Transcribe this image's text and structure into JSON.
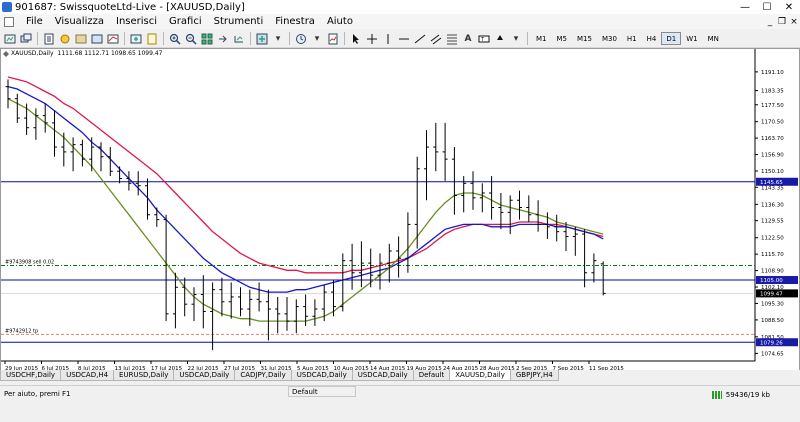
{
  "window": {
    "title": "901687: SwissquoteLtd-Live - [XAUUSD,Daily]",
    "minimize_glyph": "—",
    "maximize_glyph": "☐",
    "close_glyph": "✕"
  },
  "menu": {
    "items": [
      "File",
      "Visualizza",
      "Inserisci",
      "Grafici",
      "Strumenti",
      "Finestra",
      "Aiuto"
    ],
    "child_minimize_glyph": "_",
    "child_restore_glyph": "❐",
    "child_close_glyph": "×"
  },
  "toolbar": {
    "timeframes": [
      "M1",
      "M5",
      "M15",
      "M30",
      "H1",
      "H4",
      "D1",
      "W1",
      "MN"
    ],
    "active_timeframe": "D1"
  },
  "chart": {
    "symbol_label": "XAUUSD,Daily",
    "ohlc_label": "1111.68 1112.71 1098.65 1099.47",
    "line_labels": {
      "sell_order": "#9743908 sell 0.02",
      "take_profit": "#9742912 tp"
    },
    "price_tags": [
      {
        "label": "1145.65",
        "color": "#1a1aa8"
      },
      {
        "label": "1105.00",
        "color": "#1a1aa8"
      },
      {
        "label": "1099.47",
        "color": "#000000"
      },
      {
        "label": "1079.26",
        "color": "#1a1aa8"
      }
    ],
    "colors": {
      "background": "#ffffff",
      "candles": "#000000",
      "ma_red": "#e0154b",
      "ma_blue": "#1818c8",
      "ma_olive": "#6b8e23",
      "hline": "#0a0aa5",
      "order_line": "#007a00",
      "tp_line": "#e08080"
    }
  },
  "chart_data": {
    "type": "candlestick",
    "title": "XAUUSD,Daily",
    "y_tick_labels": [
      "1191.10",
      "1183.35",
      "1177.50",
      "1170.50",
      "1163.70",
      "1156.90",
      "1150.10",
      "1143.35",
      "1136.30",
      "1129.55",
      "1122.50",
      "1115.70",
      "1108.90",
      "1102.10",
      "1095.30",
      "1088.50",
      "1081.50",
      "1074.65"
    ],
    "x_tick_labels": [
      "29 Jun 2015",
      "6 Jul 2015",
      "8 Jul 2015",
      "13 Jul 2015",
      "17 Jul 2015",
      "22 Jul 2015",
      "27 Jul 2015",
      "31 Jul 2015",
      "5 Aug 2015",
      "10 Aug 2015",
      "14 Aug 2015",
      "19 Aug 2015",
      "24 Aug 2015",
      "28 Aug 2015",
      "2 Sep 2015",
      "7 Sep 2015",
      "11 Sep 2015"
    ],
    "ylim": [
      1071.5,
      1195.6
    ],
    "candles": [
      [
        1185,
        1188,
        1176,
        1180
      ],
      [
        1180,
        1182,
        1170,
        1172
      ],
      [
        1172,
        1178,
        1165,
        1168
      ],
      [
        1168,
        1176,
        1163,
        1173
      ],
      [
        1173,
        1178,
        1166,
        1170
      ],
      [
        1170,
        1175,
        1156,
        1160
      ],
      [
        1160,
        1166,
        1152,
        1158
      ],
      [
        1158,
        1164,
        1150,
        1161
      ],
      [
        1161,
        1163,
        1152,
        1155
      ],
      [
        1155,
        1164,
        1150,
        1160
      ],
      [
        1160,
        1162,
        1150,
        1156
      ],
      [
        1156,
        1160,
        1148,
        1150
      ],
      [
        1150,
        1152,
        1145,
        1147
      ],
      [
        1147,
        1150,
        1142,
        1145
      ],
      [
        1145,
        1150,
        1140,
        1144
      ],
      [
        1144,
        1147,
        1130,
        1132
      ],
      [
        1132,
        1135,
        1127,
        1130
      ],
      [
        1130,
        1132,
        1088,
        1091
      ],
      [
        1091,
        1108,
        1085,
        1102
      ],
      [
        1102,
        1106,
        1090,
        1095
      ],
      [
        1095,
        1102,
        1088,
        1099
      ],
      [
        1099,
        1107,
        1085,
        1092
      ],
      [
        1092,
        1104,
        1076,
        1101
      ],
      [
        1101,
        1106,
        1090,
        1096
      ],
      [
        1096,
        1104,
        1089,
        1098
      ],
      [
        1098,
        1102,
        1090,
        1093
      ],
      [
        1093,
        1101,
        1086,
        1097
      ],
      [
        1097,
        1104,
        1092,
        1096
      ],
      [
        1096,
        1101,
        1080,
        1093
      ],
      [
        1093,
        1098,
        1083,
        1091
      ],
      [
        1091,
        1098,
        1084,
        1088
      ],
      [
        1088,
        1097,
        1083,
        1094
      ],
      [
        1094,
        1099,
        1086,
        1090
      ],
      [
        1090,
        1097,
        1086,
        1093
      ],
      [
        1093,
        1103,
        1088,
        1100
      ],
      [
        1100,
        1105,
        1090,
        1094
      ],
      [
        1094,
        1116,
        1092,
        1113
      ],
      [
        1113,
        1120,
        1101,
        1108
      ],
      [
        1108,
        1121,
        1102,
        1112
      ],
      [
        1112,
        1118,
        1102,
        1107
      ],
      [
        1107,
        1116,
        1101,
        1112
      ],
      [
        1112,
        1120,
        1104,
        1117
      ],
      [
        1117,
        1123,
        1106,
        1114
      ],
      [
        1114,
        1133,
        1108,
        1128
      ],
      [
        1128,
        1156,
        1118,
        1151
      ],
      [
        1151,
        1167,
        1138,
        1160
      ],
      [
        1160,
        1170,
        1150,
        1158
      ],
      [
        1158,
        1170,
        1146,
        1155
      ],
      [
        1155,
        1160,
        1132,
        1140
      ],
      [
        1140,
        1148,
        1133,
        1145
      ],
      [
        1145,
        1150,
        1134,
        1139
      ],
      [
        1139,
        1145,
        1133,
        1141
      ],
      [
        1141,
        1148,
        1130,
        1135
      ],
      [
        1135,
        1141,
        1126,
        1133
      ],
      [
        1133,
        1140,
        1124,
        1138
      ],
      [
        1138,
        1142,
        1130,
        1135
      ],
      [
        1135,
        1140,
        1129,
        1132
      ],
      [
        1132,
        1138,
        1125,
        1128
      ],
      [
        1128,
        1133,
        1122,
        1127
      ],
      [
        1127,
        1132,
        1121,
        1125
      ],
      [
        1125,
        1129,
        1117,
        1123
      ],
      [
        1123,
        1127,
        1115,
        1124
      ],
      [
        1124,
        1126,
        1102,
        1108
      ],
      [
        1108,
        1116,
        1104,
        1113
      ],
      [
        1111.68,
        1112.71,
        1098.65,
        1099.47
      ]
    ],
    "series": [
      {
        "values": [
          1189,
          1188,
          1187,
          1185,
          1183,
          1181,
          1178,
          1176,
          1173,
          1170,
          1167,
          1164,
          1161,
          1158,
          1155,
          1152,
          1149,
          1145,
          1141,
          1137,
          1133,
          1129,
          1125,
          1122,
          1119,
          1116,
          1114,
          1112,
          1111,
          1110,
          1109,
          1109,
          1108,
          1108,
          1108,
          1108,
          1108,
          1109,
          1109,
          1110,
          1111,
          1112,
          1113,
          1114,
          1116,
          1118,
          1121,
          1124,
          1126,
          1127,
          1128,
          1128,
          1128,
          1128,
          1128,
          1129,
          1129,
          1129,
          1128,
          1128,
          1127,
          1126,
          1125,
          1124,
          1123
        ]
      },
      {
        "values": [
          1185,
          1184,
          1182,
          1180,
          1178,
          1175,
          1172,
          1169,
          1166,
          1162,
          1159,
          1155,
          1151,
          1147,
          1143,
          1139,
          1134,
          1130,
          1126,
          1122,
          1118,
          1114,
          1111,
          1108,
          1106,
          1104,
          1102,
          1101,
          1100,
          1100,
          1100,
          1101,
          1101,
          1102,
          1103,
          1104,
          1105,
          1106,
          1107,
          1108,
          1109,
          1110,
          1112,
          1114,
          1117,
          1120,
          1123,
          1126,
          1127,
          1128,
          1128,
          1128,
          1127,
          1127,
          1127,
          1128,
          1128,
          1128,
          1128,
          1127,
          1127,
          1126,
          1125,
          1124,
          1122
        ]
      },
      {
        "values": [
          1180,
          1178,
          1176,
          1173,
          1170,
          1167,
          1164,
          1160,
          1156,
          1152,
          1147,
          1142,
          1137,
          1132,
          1127,
          1122,
          1117,
          1112,
          1107,
          1102,
          1098,
          1095,
          1093,
          1091,
          1090,
          1089,
          1089,
          1088,
          1088,
          1088,
          1088,
          1088,
          1088,
          1089,
          1090,
          1092,
          1095,
          1098,
          1101,
          1104,
          1107,
          1110,
          1114,
          1118,
          1123,
          1128,
          1133,
          1137,
          1140,
          1141,
          1141,
          1140,
          1138,
          1136,
          1135,
          1134,
          1133,
          1132,
          1131,
          1129,
          1128,
          1127,
          1126,
          1125,
          1124
        ]
      }
    ],
    "hlines": [
      1145.65,
      1105.0,
      1079.26
    ],
    "order_lines": [
      1111.0,
      1082.5
    ],
    "current_price": 1099.47
  },
  "tabs": [
    "USDCHF,Daily",
    "USDCAD,H4",
    "EURUSD,Daily",
    "USDCAD,Daily",
    "CADJPY,Daily",
    "USDCAD,Daily",
    "USDCAD,Daily",
    "Default",
    "XAUUSD,Daily",
    "GBPJPY,H4"
  ],
  "active_tab": "XAUUSD,Daily",
  "status": {
    "help": "Per aiuto, premi F1",
    "profile": "Default",
    "traffic": "59436/19 kb"
  }
}
